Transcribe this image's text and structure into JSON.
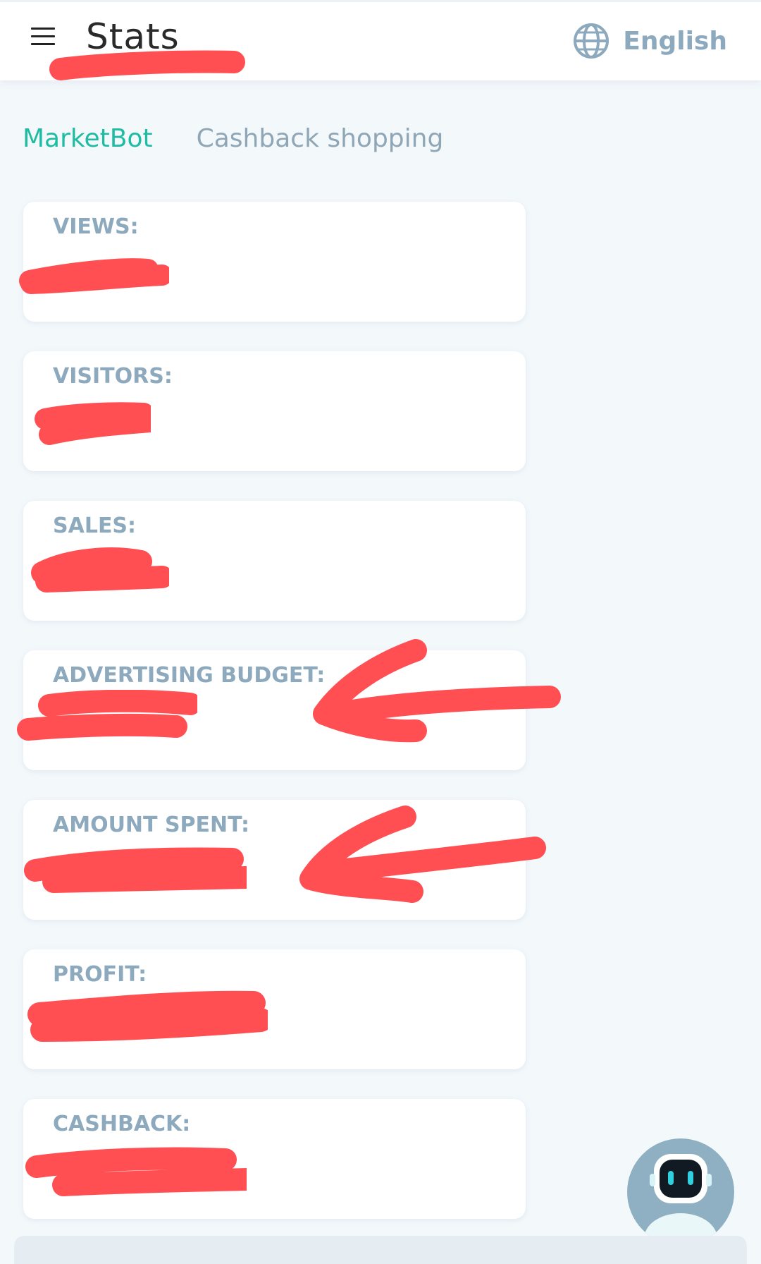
{
  "header": {
    "title": "Stats",
    "language": "English"
  },
  "tabs": [
    {
      "label": "MarketBot",
      "active": true
    },
    {
      "label": "Cashback shopping",
      "active": false
    }
  ],
  "stats": [
    {
      "label": "VIEWS:"
    },
    {
      "label": "VISITORS:"
    },
    {
      "label": "SALES:"
    },
    {
      "label": "ADVERTISING BUDGET:"
    },
    {
      "label": "AMOUNT SPENT:"
    },
    {
      "label": "PROFIT:"
    },
    {
      "label": "CASHBACK:"
    }
  ],
  "colors": {
    "accent": "#1fbca4",
    "muted_label": "#8ca9be",
    "redaction": "#ff4f52",
    "background": "#f3f8fb"
  },
  "icons": {
    "menu": "hamburger-icon",
    "language": "globe-icon",
    "assistant": "robot-icon"
  }
}
